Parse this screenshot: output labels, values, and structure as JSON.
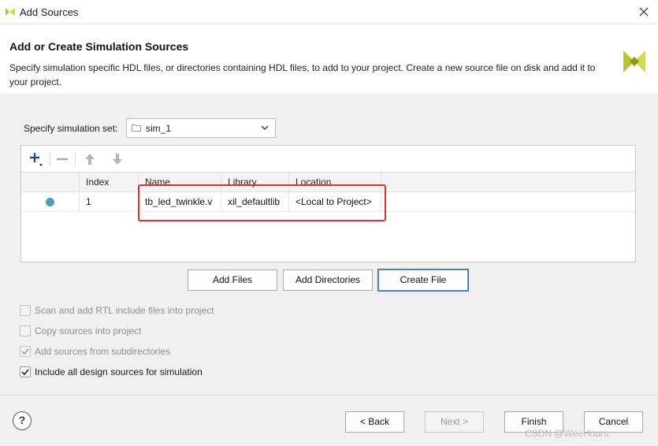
{
  "window": {
    "title": "Add Sources"
  },
  "header": {
    "title": "Add or Create Simulation Sources",
    "description": "Specify simulation specific HDL files, or directories containing HDL files, to add to your project. Create a new source file on disk and add it to your project."
  },
  "simulation_set": {
    "label": "Specify simulation set:",
    "value": "sim_1"
  },
  "table": {
    "columns": [
      "",
      "Index",
      "Name",
      "Library",
      "Location"
    ],
    "rows": [
      {
        "status_color": "#4e9cb5",
        "index": "1",
        "name": "tb_led_twinkle.v",
        "library": "xil_defaultlib",
        "location": "<Local to Project>"
      }
    ]
  },
  "actions": {
    "add_files": "Add Files",
    "add_directories": "Add Directories",
    "create_file": "Create File"
  },
  "options": [
    {
      "label": "Scan and add RTL include files into project",
      "checked": false,
      "enabled": false
    },
    {
      "label": "Copy sources into project",
      "checked": false,
      "enabled": false
    },
    {
      "label": "Add sources from subdirectories",
      "checked": true,
      "enabled": false
    },
    {
      "label": "Include all design sources for simulation",
      "checked": true,
      "enabled": true
    }
  ],
  "footer": {
    "help": "?",
    "back": "< Back",
    "next": "Next >",
    "finish": "Finish",
    "cancel": "Cancel"
  },
  "watermark": "CSDN @WeeHours.",
  "colors": {
    "accent": "#2f6fbf",
    "highlight": "#e03030",
    "logo": "#b9c631"
  }
}
